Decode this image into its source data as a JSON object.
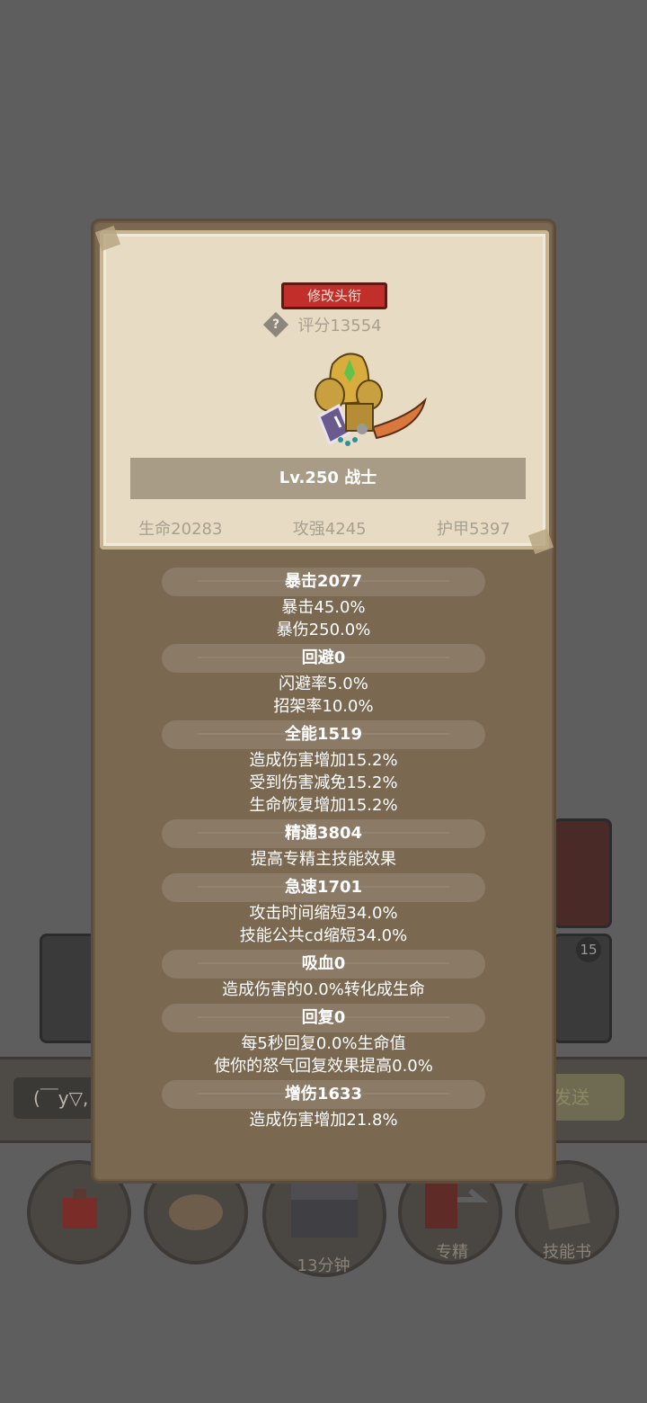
{
  "background": {
    "chat_placeholder": "(￣y▽,",
    "send_label": "发送",
    "buttons": [
      {
        "label": "",
        "icon": "potion-icon"
      },
      {
        "label": "",
        "icon": "bread-icon"
      },
      {
        "label": "13分钟",
        "icon": "treasure-chest-icon"
      },
      {
        "label": "专精",
        "icon": "specialization-icon"
      },
      {
        "label": "技能书",
        "icon": "skill-book-icon"
      }
    ],
    "badge": "15"
  },
  "profile": {
    "rename_label": "修改头衔",
    "score": "评分13554",
    "level_class": "Lv.250 战士",
    "base_stats": [
      "生命20283",
      "攻强4245",
      "护甲5397"
    ]
  },
  "stat_groups": [
    {
      "title": "暴击2077",
      "lines": [
        "暴击45.0%",
        "暴伤250.0%"
      ]
    },
    {
      "title": "回避0",
      "lines": [
        "闪避率5.0%",
        "招架率10.0%"
      ]
    },
    {
      "title": "全能1519",
      "lines": [
        "造成伤害增加15.2%",
        "受到伤害减免15.2%",
        "生命恢复增加15.2%"
      ]
    },
    {
      "title": "精通3804",
      "lines": [
        "提高专精主技能效果"
      ]
    },
    {
      "title": "急速1701",
      "lines": [
        "攻击时间缩短34.0%",
        "技能公共cd缩短34.0%"
      ]
    },
    {
      "title": "吸血0",
      "lines": [
        "造成伤害的0.0%转化成生命"
      ]
    },
    {
      "title": "回复0",
      "lines": [
        "每5秒回复0.0%生命值",
        "使你的怒气回复效果提高0.0%"
      ]
    },
    {
      "title": "增伤1633",
      "lines": [
        "造成伤害增加21.8%"
      ]
    }
  ]
}
